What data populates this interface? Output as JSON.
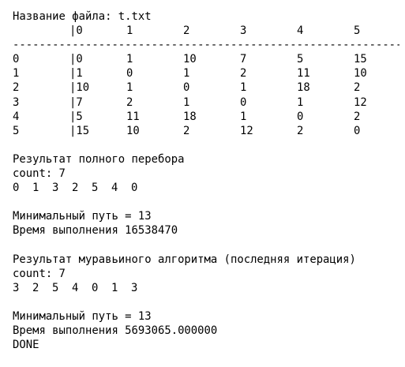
{
  "file_line": "Название файла: t.txt",
  "matrix": {
    "header": [
      "",
      "|0",
      "1",
      "2",
      "3",
      "4",
      "5"
    ],
    "divider": "-----------------------------------------------------------------",
    "rows": [
      [
        "0",
        "|0",
        "1",
        "10",
        "7",
        "5",
        "15"
      ],
      [
        "1",
        "|1",
        "0",
        "1",
        "2",
        "11",
        "10"
      ],
      [
        "2",
        "|10",
        "1",
        "0",
        "1",
        "18",
        "2"
      ],
      [
        "3",
        "|7",
        "2",
        "1",
        "0",
        "1",
        "12"
      ],
      [
        "4",
        "|5",
        "11",
        "18",
        "1",
        "0",
        "2"
      ],
      [
        "5",
        "|15",
        "10",
        "2",
        "12",
        "2",
        "0"
      ]
    ]
  },
  "brute_force": {
    "title": "Результат полного перебора",
    "count": "count: 7",
    "path": [
      "0",
      "1",
      "3",
      "2",
      "5",
      "4",
      "0"
    ],
    "min_path": "Минимальный путь = 13",
    "time": "Время выполнения 16538470"
  },
  "ant": {
    "title": "Результат муравьиного алгоритма (последняя итерация)",
    "count": "count: 7",
    "path": [
      "3",
      "2",
      "5",
      "4",
      "0",
      "1",
      "3"
    ],
    "min_path": "Минимальный путь = 13",
    "time": "Время выполнения 5693065.000000"
  },
  "done": "DONE"
}
